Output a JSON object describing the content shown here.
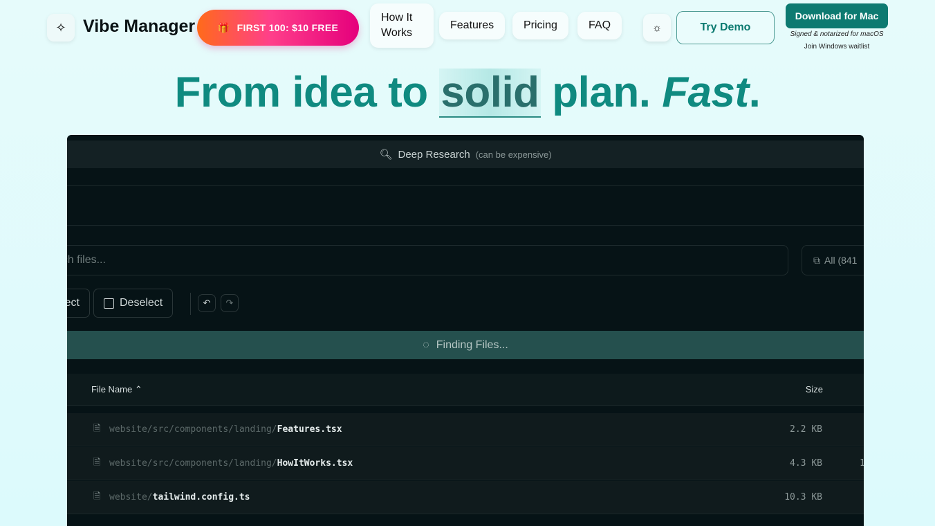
{
  "header": {
    "brand": "Vibe Manager",
    "promo": "FIRST 100: $10 FREE",
    "nav": [
      "How It\nWorks",
      "Features",
      "Pricing",
      "FAQ"
    ],
    "try_demo": "Try Demo",
    "download": "Download for Mac",
    "signed": "Signed & notarized for macOS",
    "windows": "Join Windows waitlist"
  },
  "hero": {
    "part1": "From idea to ",
    "highlight": "solid",
    "part2": " plan. ",
    "fast": "Fast",
    "dot": "."
  },
  "app": {
    "deep_research": "Deep Research",
    "deep_note": "(can be expensive)",
    "search_placeholder": "Search files...",
    "all_filter": "All (841",
    "select_label": "Select",
    "deselect_label": "Deselect",
    "finding": "Finding Files...",
    "columns": {
      "name": "File Name",
      "size": "Size"
    },
    "rows": [
      {
        "dir": "website/src/components/landing/",
        "file": "Features.tsx",
        "size": "2.2 KB",
        "extra": ""
      },
      {
        "dir": "website/src/components/landing/",
        "file": "HowItWorks.tsx",
        "size": "4.3 KB",
        "extra": "1"
      },
      {
        "dir": "website/",
        "file": "tailwind.config.ts",
        "size": "10.3 KB",
        "extra": ""
      }
    ]
  },
  "colors": {
    "accent": "#0f8a80",
    "panel": "#061316",
    "finding_bar": "#25504e"
  }
}
